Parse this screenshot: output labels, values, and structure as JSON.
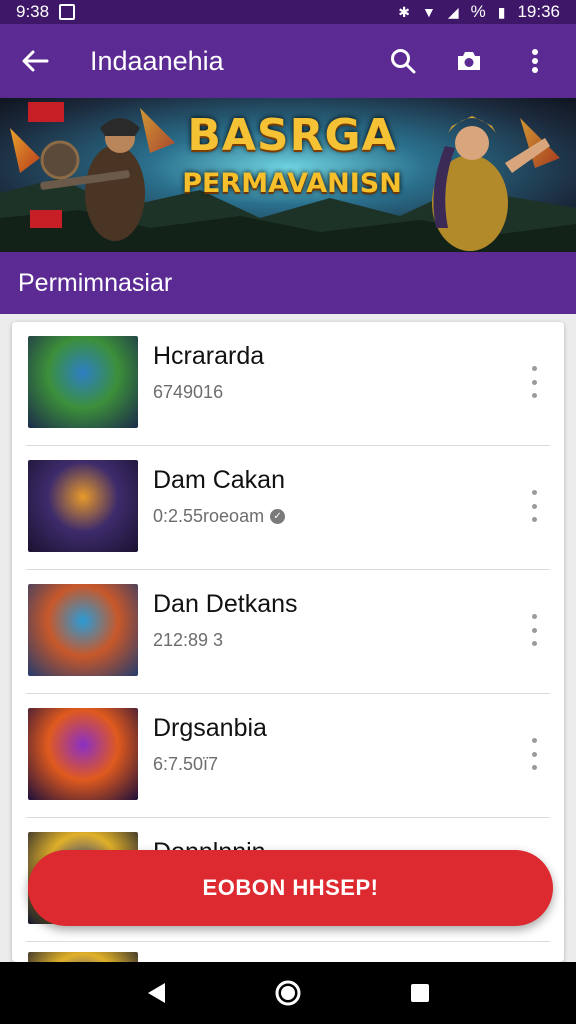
{
  "status_bar": {
    "time_left": "9:38",
    "battery_percent_label": "%",
    "time_right": "19:36"
  },
  "app_bar": {
    "title": "Indaanehia"
  },
  "banner": {
    "line1": "BASRGA",
    "line2": "PERMAVANISN"
  },
  "section": {
    "title": "Permimnasiar"
  },
  "list": {
    "items": [
      {
        "name": "Hcrararda",
        "subtitle": "6749016",
        "verified": false,
        "thumb_colors": [
          "#2d7fc4",
          "#3c8f3a",
          "#1b2a4a"
        ]
      },
      {
        "name": "Dam Cakan",
        "subtitle": "0:2.55roeoam",
        "verified": true,
        "thumb_colors": [
          "#e89a2a",
          "#3d2b6b",
          "#1a1230"
        ]
      },
      {
        "name": "Dan Detkans",
        "subtitle": "212:89 3",
        "verified": false,
        "thumb_colors": [
          "#2a9bd6",
          "#c8582a",
          "#243b6d"
        ]
      },
      {
        "name": "Drgsanbia",
        "subtitle": "6:7.50ï7",
        "verified": false,
        "thumb_colors": [
          "#8a2fc6",
          "#e05a1e",
          "#1d0f3a"
        ]
      },
      {
        "name": "Donnlnnin",
        "subtitle": "",
        "verified": false,
        "thumb_colors": [
          "#2f3e8f",
          "#e0b02a",
          "#0e1430"
        ]
      }
    ]
  },
  "fab": {
    "label": "EOBON HHSEP!"
  },
  "colors": {
    "primary": "#5b2a93",
    "status": "#3f1769",
    "accent": "#dd2a31"
  },
  "icons": {
    "back": "arrow-left-icon",
    "search": "search-icon",
    "camera": "camera-icon",
    "more": "more-vertical-icon",
    "nav_back": "triangle-back-icon",
    "nav_home": "circle-home-icon",
    "nav_recents": "square-recents-icon"
  }
}
